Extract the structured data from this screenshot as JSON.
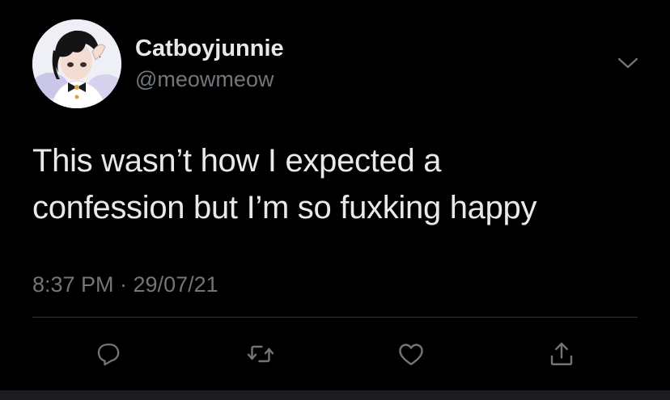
{
  "tweet": {
    "author": {
      "display_name": "Catboyjunnie",
      "handle": "@meowmeow"
    },
    "text_lines": [
      "This wasn’t how I expected a",
      "confession but I’m so fuxking happy"
    ],
    "timestamp": "8:37 PM · 29/07/21"
  },
  "icons": {
    "more": "chevron-down-icon",
    "reply": "reply-icon",
    "retweet": "retweet-icon",
    "like": "heart-icon",
    "share": "share-icon"
  },
  "colors": {
    "background": "#000000",
    "primary_text": "#e7e9ea",
    "secondary_text": "#71767b",
    "divider": "#2f3336"
  }
}
